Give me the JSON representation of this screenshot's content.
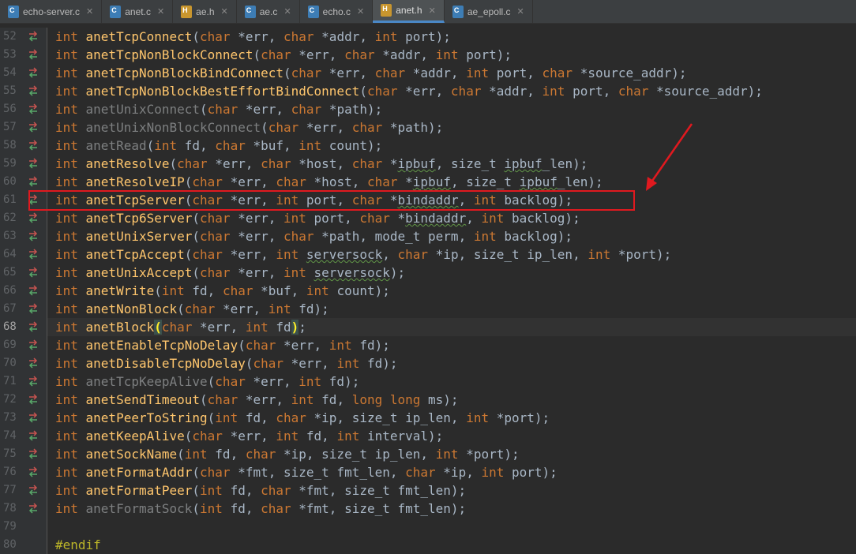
{
  "tabs": [
    {
      "label": "echo-server.c",
      "kind": "c",
      "active": false
    },
    {
      "label": "anet.c",
      "kind": "c",
      "active": false
    },
    {
      "label": "ae.h",
      "kind": "h",
      "active": false
    },
    {
      "label": "ae.c",
      "kind": "c",
      "active": false
    },
    {
      "label": "echo.c",
      "kind": "c",
      "active": false
    },
    {
      "label": "anet.h",
      "kind": "h",
      "active": true
    },
    {
      "label": "ae_epoll.c",
      "kind": "c",
      "active": false
    }
  ],
  "colors": {
    "keyword": "#cc7832",
    "function": "#ffc66d",
    "unused_function": "#7d7f80",
    "plain": "#a9b7c6",
    "annotation": "#e0191f"
  },
  "editor": {
    "current_line": 68,
    "annotated_line": 61,
    "lines": [
      {
        "num": "52",
        "icon": "override-arrows-icon",
        "tokens": [
          [
            "int ",
            "kw"
          ],
          [
            "anetTcpConnect",
            "fn"
          ],
          [
            "(",
            ""
          ],
          [
            "char ",
            "kw"
          ],
          [
            "*err, ",
            ""
          ],
          [
            "char ",
            "kw"
          ],
          [
            "*addr, ",
            ""
          ],
          [
            "int ",
            "kw"
          ],
          [
            "port);",
            ""
          ]
        ]
      },
      {
        "num": "53",
        "icon": "override-arrows-icon",
        "tokens": [
          [
            "int ",
            "kw"
          ],
          [
            "anetTcpNonBlockConnect",
            "fn"
          ],
          [
            "(",
            ""
          ],
          [
            "char ",
            "kw"
          ],
          [
            "*err, ",
            ""
          ],
          [
            "char ",
            "kw"
          ],
          [
            "*addr, ",
            ""
          ],
          [
            "int ",
            "kw"
          ],
          [
            "port);",
            ""
          ]
        ]
      },
      {
        "num": "54",
        "icon": "override-arrows-icon",
        "tokens": [
          [
            "int ",
            "kw"
          ],
          [
            "anetTcpNonBlockBindConnect",
            "fn"
          ],
          [
            "(",
            ""
          ],
          [
            "char ",
            "kw"
          ],
          [
            "*err, ",
            ""
          ],
          [
            "char ",
            "kw"
          ],
          [
            "*addr, ",
            ""
          ],
          [
            "int ",
            "kw"
          ],
          [
            "port, ",
            ""
          ],
          [
            "char ",
            "kw"
          ],
          [
            "*source_addr);",
            ""
          ]
        ]
      },
      {
        "num": "55",
        "icon": "override-arrows-icon",
        "tokens": [
          [
            "int ",
            "kw"
          ],
          [
            "anetTcpNonBlockBestEffortBindConnect",
            "fn"
          ],
          [
            "(",
            ""
          ],
          [
            "char ",
            "kw"
          ],
          [
            "*err, ",
            ""
          ],
          [
            "char ",
            "kw"
          ],
          [
            "*addr, ",
            ""
          ],
          [
            "int ",
            "kw"
          ],
          [
            "port, ",
            ""
          ],
          [
            "char ",
            "kw"
          ],
          [
            "*source_addr);",
            ""
          ]
        ]
      },
      {
        "num": "56",
        "icon": "override-arrows-icon",
        "tokens": [
          [
            "int ",
            "kw"
          ],
          [
            "anetUnixConnect",
            "fn unused"
          ],
          [
            "(",
            ""
          ],
          [
            "char ",
            "kw"
          ],
          [
            "*err, ",
            ""
          ],
          [
            "char ",
            "kw"
          ],
          [
            "*path);",
            ""
          ]
        ]
      },
      {
        "num": "57",
        "icon": "override-arrows-icon",
        "tokens": [
          [
            "int ",
            "kw"
          ],
          [
            "anetUnixNonBlockConnect",
            "fn unused"
          ],
          [
            "(",
            ""
          ],
          [
            "char ",
            "kw"
          ],
          [
            "*err, ",
            ""
          ],
          [
            "char ",
            "kw"
          ],
          [
            "*path);",
            ""
          ]
        ]
      },
      {
        "num": "58",
        "icon": "override-arrows-icon",
        "tokens": [
          [
            "int ",
            "kw"
          ],
          [
            "anetRead",
            "fn unused"
          ],
          [
            "(",
            ""
          ],
          [
            "int ",
            "kw"
          ],
          [
            "fd, ",
            ""
          ],
          [
            "char ",
            "kw"
          ],
          [
            "*buf, ",
            ""
          ],
          [
            "int ",
            "kw"
          ],
          [
            "count);",
            ""
          ]
        ]
      },
      {
        "num": "59",
        "icon": "override-arrows-icon",
        "tokens": [
          [
            "int ",
            "kw"
          ],
          [
            "anetResolve",
            "fn"
          ],
          [
            "(",
            ""
          ],
          [
            "char ",
            "kw"
          ],
          [
            "*err, ",
            ""
          ],
          [
            "char ",
            "kw"
          ],
          [
            "*host, ",
            ""
          ],
          [
            "char ",
            "kw"
          ],
          [
            "*",
            ""
          ],
          [
            "ipbuf",
            "typo"
          ],
          [
            ", size_t ",
            ""
          ],
          [
            "ipbuf",
            "typo"
          ],
          [
            "_len);",
            ""
          ]
        ]
      },
      {
        "num": "60",
        "icon": "override-arrows-icon",
        "tokens": [
          [
            "int ",
            "kw"
          ],
          [
            "anetResolveIP",
            "fn"
          ],
          [
            "(",
            ""
          ],
          [
            "char ",
            "kw"
          ],
          [
            "*err, ",
            ""
          ],
          [
            "char ",
            "kw"
          ],
          [
            "*host, ",
            ""
          ],
          [
            "char ",
            "kw"
          ],
          [
            "*",
            ""
          ],
          [
            "ipbuf",
            "typo"
          ],
          [
            ", size_t ",
            ""
          ],
          [
            "ipbuf",
            "typo"
          ],
          [
            "_len);",
            ""
          ]
        ]
      },
      {
        "num": "61",
        "icon": "override-arrows-icon",
        "tokens": [
          [
            "int ",
            "kw"
          ],
          [
            "anetTcpServer",
            "fn"
          ],
          [
            "(",
            ""
          ],
          [
            "char ",
            "kw"
          ],
          [
            "*err, ",
            ""
          ],
          [
            "int ",
            "kw"
          ],
          [
            "port, ",
            ""
          ],
          [
            "char ",
            "kw"
          ],
          [
            "*",
            ""
          ],
          [
            "bindaddr",
            "typo"
          ],
          [
            ", ",
            ""
          ],
          [
            "int ",
            "kw"
          ],
          [
            "backlog);",
            ""
          ]
        ]
      },
      {
        "num": "62",
        "icon": "override-arrows-icon",
        "tokens": [
          [
            "int ",
            "kw"
          ],
          [
            "anetTcp6Server",
            "fn"
          ],
          [
            "(",
            ""
          ],
          [
            "char ",
            "kw"
          ],
          [
            "*err, ",
            ""
          ],
          [
            "int ",
            "kw"
          ],
          [
            "port, ",
            ""
          ],
          [
            "char ",
            "kw"
          ],
          [
            "*",
            ""
          ],
          [
            "bindaddr",
            "typo"
          ],
          [
            ", ",
            ""
          ],
          [
            "int ",
            "kw"
          ],
          [
            "backlog);",
            ""
          ]
        ]
      },
      {
        "num": "63",
        "icon": "override-arrows-icon",
        "tokens": [
          [
            "int ",
            "kw"
          ],
          [
            "anetUnixServer",
            "fn"
          ],
          [
            "(",
            ""
          ],
          [
            "char ",
            "kw"
          ],
          [
            "*err, ",
            ""
          ],
          [
            "char ",
            "kw"
          ],
          [
            "*path, mode_t perm, ",
            ""
          ],
          [
            "int ",
            "kw"
          ],
          [
            "backlog);",
            ""
          ]
        ]
      },
      {
        "num": "64",
        "icon": "override-arrows-icon",
        "tokens": [
          [
            "int ",
            "kw"
          ],
          [
            "anetTcpAccept",
            "fn"
          ],
          [
            "(",
            ""
          ],
          [
            "char ",
            "kw"
          ],
          [
            "*err, ",
            ""
          ],
          [
            "int ",
            "kw"
          ],
          [
            "serversock",
            "typo"
          ],
          [
            ", ",
            ""
          ],
          [
            "char ",
            "kw"
          ],
          [
            "*ip, size_t ip_len, ",
            ""
          ],
          [
            "int ",
            "kw"
          ],
          [
            "*port);",
            ""
          ]
        ]
      },
      {
        "num": "65",
        "icon": "override-arrows-icon",
        "tokens": [
          [
            "int ",
            "kw"
          ],
          [
            "anetUnixAccept",
            "fn"
          ],
          [
            "(",
            ""
          ],
          [
            "char ",
            "kw"
          ],
          [
            "*err, ",
            ""
          ],
          [
            "int ",
            "kw"
          ],
          [
            "serversock",
            "typo"
          ],
          [
            ");",
            ""
          ]
        ]
      },
      {
        "num": "66",
        "icon": "override-arrows-icon",
        "tokens": [
          [
            "int ",
            "kw"
          ],
          [
            "anetWrite",
            "fn"
          ],
          [
            "(",
            ""
          ],
          [
            "int ",
            "kw"
          ],
          [
            "fd, ",
            ""
          ],
          [
            "char ",
            "kw"
          ],
          [
            "*buf, ",
            ""
          ],
          [
            "int ",
            "kw"
          ],
          [
            "count);",
            ""
          ]
        ]
      },
      {
        "num": "67",
        "icon": "override-arrows-icon",
        "tokens": [
          [
            "int ",
            "kw"
          ],
          [
            "anetNonBlock",
            "fn"
          ],
          [
            "(",
            ""
          ],
          [
            "char ",
            "kw"
          ],
          [
            "*err, ",
            ""
          ],
          [
            "int ",
            "kw"
          ],
          [
            "fd);",
            ""
          ]
        ]
      },
      {
        "num": "68",
        "icon": "override-arrows-icon",
        "tokens": [
          [
            "int ",
            "kw"
          ],
          [
            "anetBlock",
            "fn"
          ],
          [
            "(",
            "brace"
          ],
          [
            "char ",
            "kw"
          ],
          [
            "*err, ",
            ""
          ],
          [
            "int ",
            "kw"
          ],
          [
            "fd",
            ""
          ],
          [
            ")",
            "brace"
          ],
          [
            ";",
            ""
          ]
        ]
      },
      {
        "num": "69",
        "icon": "override-arrows-icon",
        "tokens": [
          [
            "int ",
            "kw"
          ],
          [
            "anetEnableTcpNoDelay",
            "fn"
          ],
          [
            "(",
            ""
          ],
          [
            "char ",
            "kw"
          ],
          [
            "*err, ",
            ""
          ],
          [
            "int ",
            "kw"
          ],
          [
            "fd);",
            ""
          ]
        ]
      },
      {
        "num": "70",
        "icon": "override-arrows-icon",
        "tokens": [
          [
            "int ",
            "kw"
          ],
          [
            "anetDisableTcpNoDelay",
            "fn"
          ],
          [
            "(",
            ""
          ],
          [
            "char ",
            "kw"
          ],
          [
            "*err, ",
            ""
          ],
          [
            "int ",
            "kw"
          ],
          [
            "fd);",
            ""
          ]
        ]
      },
      {
        "num": "71",
        "icon": "override-arrows-icon",
        "tokens": [
          [
            "int ",
            "kw"
          ],
          [
            "anetTcpKeepAlive",
            "fn unused"
          ],
          [
            "(",
            ""
          ],
          [
            "char ",
            "kw"
          ],
          [
            "*err, ",
            ""
          ],
          [
            "int ",
            "kw"
          ],
          [
            "fd);",
            ""
          ]
        ]
      },
      {
        "num": "72",
        "icon": "override-arrows-icon",
        "tokens": [
          [
            "int ",
            "kw"
          ],
          [
            "anetSendTimeout",
            "fn"
          ],
          [
            "(",
            ""
          ],
          [
            "char ",
            "kw"
          ],
          [
            "*err, ",
            ""
          ],
          [
            "int ",
            "kw"
          ],
          [
            "fd, ",
            ""
          ],
          [
            "long long ",
            "kw"
          ],
          [
            "ms);",
            ""
          ]
        ]
      },
      {
        "num": "73",
        "icon": "override-arrows-icon",
        "tokens": [
          [
            "int ",
            "kw"
          ],
          [
            "anetPeerToString",
            "fn"
          ],
          [
            "(",
            ""
          ],
          [
            "int ",
            "kw"
          ],
          [
            "fd, ",
            ""
          ],
          [
            "char ",
            "kw"
          ],
          [
            "*ip, size_t ip_len, ",
            ""
          ],
          [
            "int ",
            "kw"
          ],
          [
            "*port);",
            ""
          ]
        ]
      },
      {
        "num": "74",
        "icon": "override-arrows-icon",
        "tokens": [
          [
            "int ",
            "kw"
          ],
          [
            "anetKeepAlive",
            "fn"
          ],
          [
            "(",
            ""
          ],
          [
            "char ",
            "kw"
          ],
          [
            "*err, ",
            ""
          ],
          [
            "int ",
            "kw"
          ],
          [
            "fd, ",
            ""
          ],
          [
            "int ",
            "kw"
          ],
          [
            "interval);",
            ""
          ]
        ]
      },
      {
        "num": "75",
        "icon": "override-arrows-icon",
        "tokens": [
          [
            "int ",
            "kw"
          ],
          [
            "anetSockName",
            "fn"
          ],
          [
            "(",
            ""
          ],
          [
            "int ",
            "kw"
          ],
          [
            "fd, ",
            ""
          ],
          [
            "char ",
            "kw"
          ],
          [
            "*ip, size_t ip_len, ",
            ""
          ],
          [
            "int ",
            "kw"
          ],
          [
            "*port);",
            ""
          ]
        ]
      },
      {
        "num": "76",
        "icon": "override-arrows-icon",
        "tokens": [
          [
            "int ",
            "kw"
          ],
          [
            "anetFormatAddr",
            "fn"
          ],
          [
            "(",
            ""
          ],
          [
            "char ",
            "kw"
          ],
          [
            "*fmt, size_t fmt_len, ",
            ""
          ],
          [
            "char ",
            "kw"
          ],
          [
            "*ip, ",
            ""
          ],
          [
            "int ",
            "kw"
          ],
          [
            "port);",
            ""
          ]
        ]
      },
      {
        "num": "77",
        "icon": "override-arrows-icon",
        "tokens": [
          [
            "int ",
            "kw"
          ],
          [
            "anetFormatPeer",
            "fn"
          ],
          [
            "(",
            ""
          ],
          [
            "int ",
            "kw"
          ],
          [
            "fd, ",
            ""
          ],
          [
            "char ",
            "kw"
          ],
          [
            "*fmt, size_t fmt_len);",
            ""
          ]
        ]
      },
      {
        "num": "78",
        "icon": "override-arrows-icon",
        "tokens": [
          [
            "int ",
            "kw"
          ],
          [
            "anetFormatSock",
            "fn unused"
          ],
          [
            "(",
            ""
          ],
          [
            "int ",
            "kw"
          ],
          [
            "fd, ",
            ""
          ],
          [
            "char ",
            "kw"
          ],
          [
            "*fmt, size_t fmt_len);",
            ""
          ]
        ]
      },
      {
        "num": "79",
        "icon": "",
        "tokens": []
      },
      {
        "num": "80",
        "icon": "",
        "tokens": [
          [
            "#endif",
            "pp"
          ]
        ]
      }
    ]
  }
}
